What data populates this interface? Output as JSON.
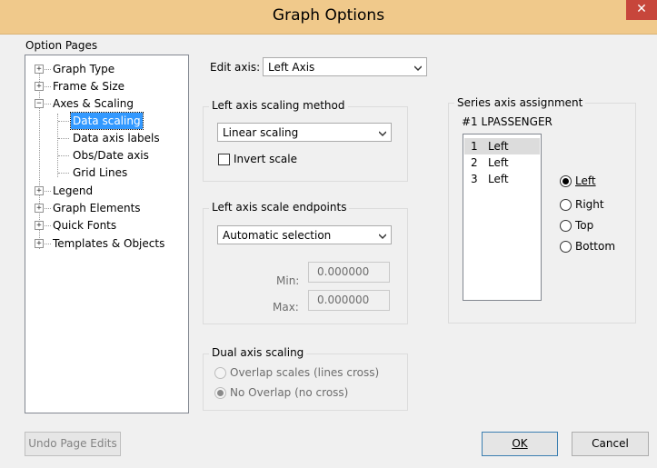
{
  "window": {
    "title": "Graph Options",
    "close_glyph": "✕"
  },
  "option_pages": {
    "label": "Option Pages",
    "items": [
      {
        "label": "Graph Type",
        "expander": "+"
      },
      {
        "label": "Frame & Size",
        "expander": "+"
      },
      {
        "label": "Axes & Scaling",
        "expander": "−"
      },
      {
        "label": "Data scaling"
      },
      {
        "label": "Data axis labels"
      },
      {
        "label": "Obs/Date axis"
      },
      {
        "label": "Grid Lines"
      },
      {
        "label": "Legend",
        "expander": "+"
      },
      {
        "label": "Graph Elements",
        "expander": "+"
      },
      {
        "label": "Quick Fonts",
        "expander": "+"
      },
      {
        "label": "Templates & Objects",
        "expander": "+"
      }
    ],
    "selected": "Data scaling"
  },
  "edit_axis": {
    "label": "Edit axis:",
    "value": "Left Axis"
  },
  "scaling_method": {
    "title": "Left axis scaling method",
    "value": "Linear scaling",
    "invert_label": "Invert scale",
    "invert_checked": false
  },
  "endpoints": {
    "title": "Left axis scale endpoints",
    "value": "Automatic selection",
    "min_label": "Min:",
    "min_value": "0.000000",
    "max_label": "Max:",
    "max_value": "0.000000"
  },
  "dual_axis": {
    "title": "Dual axis scaling",
    "overlap_label": "Overlap scales  (lines cross)",
    "no_overlap_label": "No Overlap (no cross)"
  },
  "series_assignment": {
    "title": "Series axis assignment",
    "series_name": "#1  LPASSENGER",
    "rows": [
      {
        "num": "1",
        "axis": "Left"
      },
      {
        "num": "2",
        "axis": "Left"
      },
      {
        "num": "3",
        "axis": "Left"
      }
    ],
    "options": [
      "Left",
      "Right",
      "Top",
      "Bottom"
    ],
    "selected_option": "Left"
  },
  "buttons": {
    "undo": "Undo Page Edits",
    "ok": "OK",
    "cancel": "Cancel"
  },
  "colors": {
    "titlebar": "#f0c98b",
    "close": "#c7463b",
    "selection": "#3399ff"
  },
  "icons": {
    "expander": "tree-expander-icon",
    "dropdown": "chevron-down-icon"
  }
}
